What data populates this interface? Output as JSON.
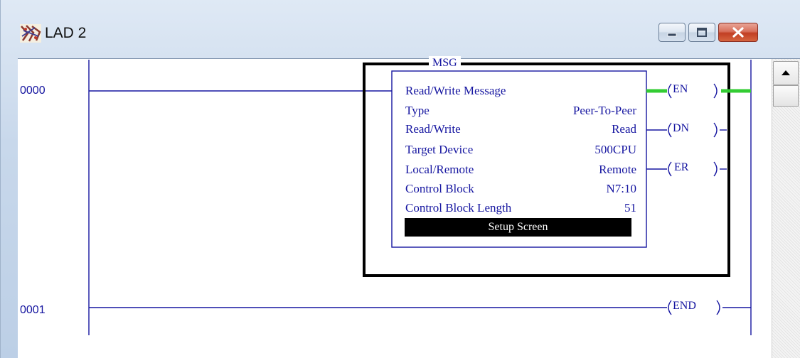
{
  "window": {
    "title": "LAD 2",
    "icon": "ladder-app-icon",
    "controls": [
      "minimize",
      "maximize",
      "close"
    ]
  },
  "rungs": [
    {
      "number": "0000"
    },
    {
      "number": "0001"
    }
  ],
  "msg_block": {
    "title": "MSG",
    "header": "Read/Write Message",
    "rows": [
      {
        "label": "Type",
        "value": "Peer-To-Peer"
      },
      {
        "label": "Read/Write",
        "value": "Read"
      },
      {
        "label": "Target Device",
        "value": "500CPU"
      },
      {
        "label": "Local/Remote",
        "value": "Remote"
      },
      {
        "label": "Control Block",
        "value": "N7:10"
      },
      {
        "label": "Control Block Length",
        "value": "51"
      }
    ],
    "setup_button": "Setup Screen",
    "outputs": [
      "EN",
      "DN",
      "ER"
    ],
    "energized_output": "EN",
    "energized_color": "#33cc33"
  },
  "end_label": "END",
  "colors": {
    "ladder": "#1515a0",
    "selection_border": "#000000"
  }
}
